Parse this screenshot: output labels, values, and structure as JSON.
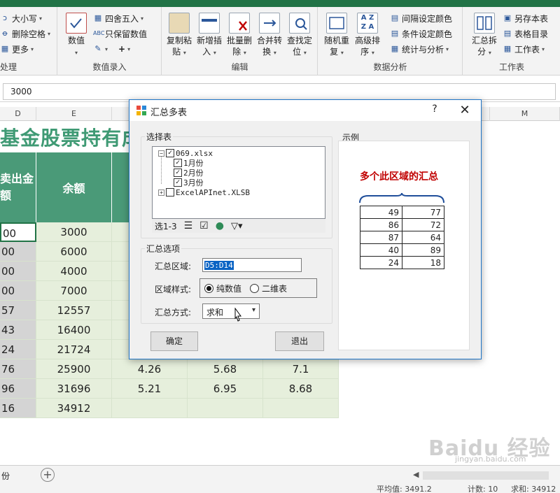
{
  "ribbon": {
    "group_left": {
      "items": [
        "大小写",
        "删除空格",
        "更多"
      ],
      "label": "处理"
    },
    "group_number": {
      "big_label": "数值",
      "items": [
        "四舍五入",
        "只保留数值"
      ],
      "label": "数值录入"
    },
    "group_edit": {
      "buttons": [
        {
          "line1": "复制粘",
          "line2": "贴"
        },
        {
          "line1": "新增插",
          "line2": "入"
        },
        {
          "line1": "批量删",
          "line2": "除"
        },
        {
          "line1": "合并转",
          "line2": "换"
        },
        {
          "line1": "查找定",
          "line2": "位"
        }
      ],
      "label": "编辑"
    },
    "group_analysis": {
      "buttons": [
        {
          "line1": "随机重",
          "line2": "复"
        },
        {
          "line1": "高级排",
          "line2": "序"
        }
      ],
      "items": [
        "间隔设定颜色",
        "条件设定颜色",
        "统计与分析"
      ],
      "label": "数据分析"
    },
    "group_workbook": {
      "big_line1": "汇总拆",
      "big_line2": "分",
      "items": [
        "另存本表",
        "表格目录",
        "工作表"
      ],
      "label": "工作表"
    }
  },
  "formula_bar": {
    "value": "3000"
  },
  "sheet": {
    "col_headers": [
      "D",
      "E",
      "",
      "",
      "",
      "",
      "M"
    ],
    "title": "基金股票持有成",
    "header_d": "卖出金\n额",
    "header_e": "余额",
    "rows": [
      {
        "d": "00",
        "e": "3000",
        "f": "",
        "g": "",
        "h": ""
      },
      {
        "d": "00",
        "e": "6000",
        "f": "",
        "g": "",
        "h": ""
      },
      {
        "d": "00",
        "e": "4000",
        "f": "",
        "g": "",
        "h": ""
      },
      {
        "d": "00",
        "e": "7000",
        "f": "",
        "g": "",
        "h": ""
      },
      {
        "d": "57",
        "e": "12557",
        "f": "",
        "g": "",
        "h": ""
      },
      {
        "d": "43",
        "e": "16400",
        "f": "",
        "g": "",
        "h": ""
      },
      {
        "d": "24",
        "e": "21724",
        "f": "",
        "g": "",
        "h": ""
      },
      {
        "d": "76",
        "e": "25900",
        "f": "4.26",
        "g": "5.68",
        "h": "7.1"
      },
      {
        "d": "96",
        "e": "31696",
        "f": "5.21",
        "g": "6.95",
        "h": "8.68"
      },
      {
        "d": "16",
        "e": "34912",
        "f": "",
        "g": "",
        "h": ""
      }
    ],
    "tab_name": "份",
    "status_avg": "平均值: 3491.2",
    "status_count": "计数: 10",
    "status_sum": "求和: 34912"
  },
  "dialog": {
    "title": "汇总多表",
    "help": "?",
    "close": "✕",
    "select_sheets_label": "选择表",
    "tree": {
      "file1": "069.xlsx",
      "sheets": [
        "1月份",
        "2月份",
        "3月份"
      ],
      "file2": "ExcelAPInet.XLSB"
    },
    "selection_text": "选1-3",
    "options_label": "汇总选项",
    "range_label": "汇总区域:",
    "range_value": "D5:D14",
    "style_label": "区域样式:",
    "style_option1": "纯数值",
    "style_option2": "二维表",
    "method_label": "汇总方式:",
    "method_value": "求和",
    "ok": "确定",
    "exit": "退出",
    "example_label": "示例",
    "example_title": "多个此区域的汇总",
    "example_rows": [
      [
        "49",
        "77"
      ],
      [
        "86",
        "72"
      ],
      [
        "87",
        "64"
      ],
      [
        "40",
        "89"
      ],
      [
        "24",
        "18"
      ]
    ]
  },
  "watermark": {
    "main": "Baidu 经验",
    "sub": "jingyan.baidu.com"
  }
}
